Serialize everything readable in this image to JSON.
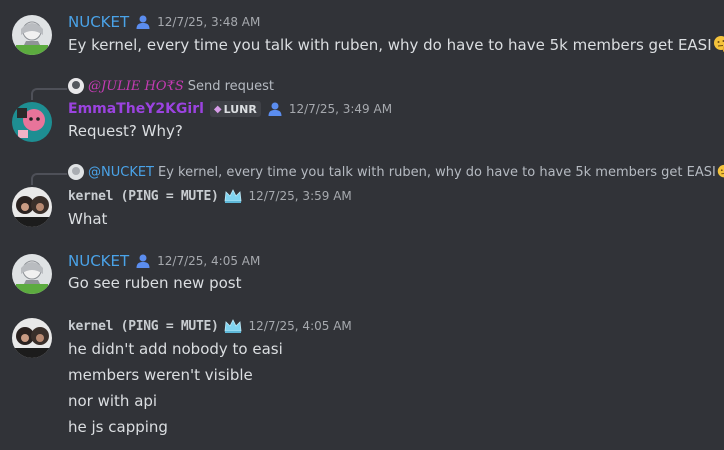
{
  "messages": [
    {
      "author": "NUCKET",
      "timestamp": "12/7/25, 3:48 AM",
      "text": "Ey kernel, every time you talk with ruben, why do have to have 5k members get EASI"
    },
    {
      "reply": {
        "author": "@JULIE HO₹S",
        "text": "Send request"
      },
      "author": "EmmaTheY2KGirl",
      "tag": "LUNR",
      "timestamp": "12/7/25, 3:49 AM",
      "text": "Request? Why?"
    },
    {
      "reply": {
        "author": "@NUCKET",
        "text": "Ey kernel, every time you talk with ruben, why do have to have 5k members get EASI"
      },
      "author": "kernel (PING = MUTE)",
      "timestamp": "12/7/25, 3:59 AM",
      "text": "What"
    },
    {
      "author": "NUCKET",
      "timestamp": "12/7/25, 4:05 AM",
      "text": "Go see ruben new post"
    },
    {
      "author": "kernel (PING = MUTE)",
      "timestamp": "12/7/25, 4:05 AM",
      "lines": [
        "he didn't add nobody to easi",
        "members weren't visible",
        "nor with api",
        "he js capping"
      ]
    }
  ],
  "colors": {
    "background": "#313338",
    "nucket_name": "#4aa3e8",
    "emma_name": "#9b43e0",
    "julie_name": "#c43bb3",
    "kernel_name": "#c9cdd1",
    "crown": "#7fd3f0"
  },
  "icons": [
    "person-icon",
    "crown-icon",
    "gem-icon",
    "thinking-emoji"
  ]
}
